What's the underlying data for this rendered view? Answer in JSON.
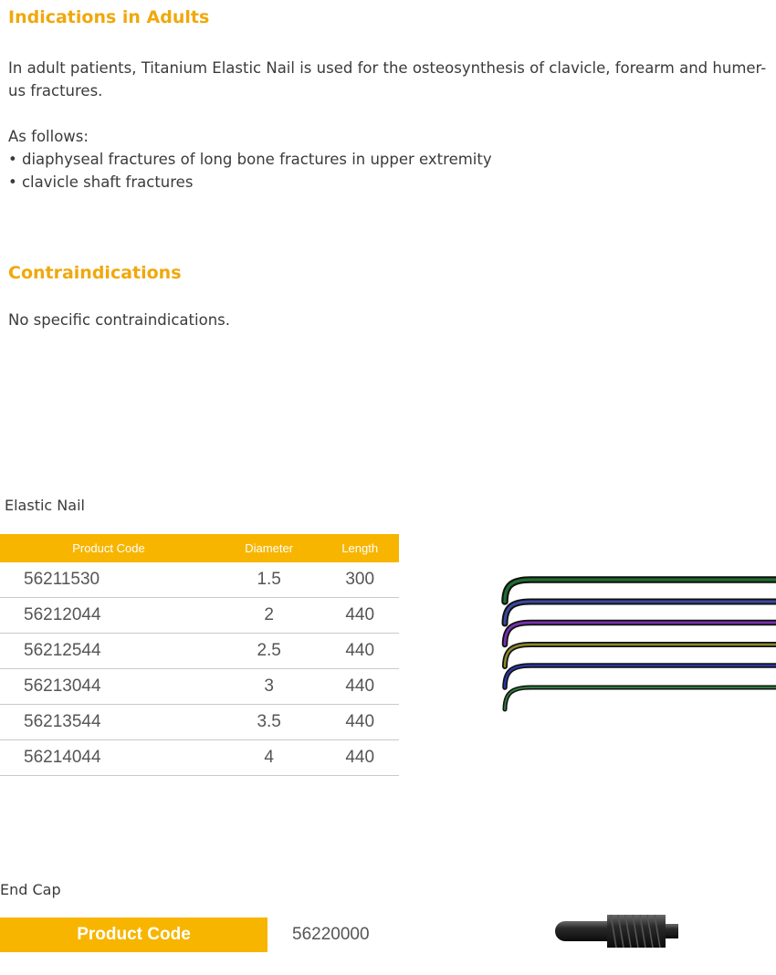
{
  "indications": {
    "heading": "Indications in Adults",
    "intro_line1": "In adult patients, Titanium Elastic Nail is used for the osteosynthesis of clavicle, forearm and humer-",
    "intro_line2": "us fractures.",
    "as_follows": "As follows:",
    "bullets": [
      "• diaphyseal fractures of long bone fractures in upper extremity",
      "• clavicle shaft fractures"
    ]
  },
  "contraindications": {
    "heading": "Contraindications",
    "text": "No specific contraindications."
  },
  "elastic_nail": {
    "caption": "Elastic Nail",
    "columns": [
      "Product Code",
      "Diameter",
      "Length"
    ],
    "rows": [
      [
        "56211530",
        "1.5",
        "300"
      ],
      [
        "56212044",
        "2",
        "440"
      ],
      [
        "56212544",
        "2.5",
        "440"
      ],
      [
        "56213044",
        "3",
        "440"
      ],
      [
        "56213544",
        "3.5",
        "440"
      ],
      [
        "56214044",
        "4",
        "440"
      ]
    ],
    "nail_colors": [
      "#1f6e2f",
      "#3a4aa0",
      "#7a2fb0",
      "#8a8a2a",
      "#2a36a8",
      "#2f7a3a"
    ]
  },
  "end_cap": {
    "caption": "End Cap",
    "label": "Product Code",
    "value": "56220000"
  },
  "colors": {
    "accent": "#f7b500",
    "heading": "#f0a80c"
  }
}
